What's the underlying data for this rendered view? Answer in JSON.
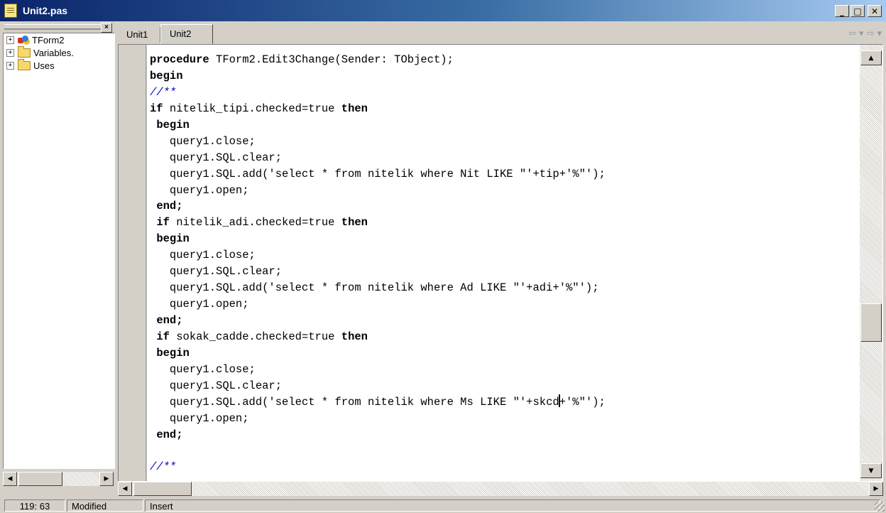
{
  "window": {
    "title": "Unit2.pas",
    "buttons": [
      "minimize",
      "maximize",
      "close"
    ]
  },
  "explorer": {
    "close_label": "×",
    "items": [
      {
        "expander": "+",
        "icon": "form-icon",
        "label": "TForm2"
      },
      {
        "expander": "+",
        "icon": "folder-icon",
        "label": "Variables."
      },
      {
        "expander": "+",
        "icon": "folder-icon",
        "label": "Uses"
      }
    ]
  },
  "editor": {
    "tabs": [
      {
        "label": "Unit1",
        "active": false
      },
      {
        "label": "Unit2",
        "active": true
      }
    ],
    "nav": {
      "back": "⇦",
      "back_drop": "▾",
      "forward": "⇨",
      "forward_drop": "▾"
    },
    "code_lines": [
      {
        "segments": [
          {
            "t": "procedure",
            "k": "kw"
          },
          {
            "t": " TForm2.Edit3Change(Sender: TObject);"
          }
        ]
      },
      {
        "segments": [
          {
            "t": "begin",
            "k": "kw"
          }
        ]
      },
      {
        "segments": [
          {
            "t": "//**",
            "k": "cm"
          }
        ]
      },
      {
        "segments": [
          {
            "t": "if",
            "k": "kw"
          },
          {
            "t": " nitelik_tipi.checked=true "
          },
          {
            "t": "then",
            "k": "kw"
          }
        ]
      },
      {
        "segments": [
          {
            "t": " "
          },
          {
            "t": "begin",
            "k": "kw"
          }
        ]
      },
      {
        "segments": [
          {
            "t": "   query1.close;"
          }
        ]
      },
      {
        "segments": [
          {
            "t": "   query1.SQL.clear;"
          }
        ]
      },
      {
        "segments": [
          {
            "t": "   query1.SQL.add('select * from nitelik where Nit LIKE \"'+tip+'%\"');"
          }
        ]
      },
      {
        "segments": [
          {
            "t": "   query1.open;"
          }
        ]
      },
      {
        "segments": [
          {
            "t": " "
          },
          {
            "t": "end;",
            "k": "kw"
          }
        ]
      },
      {
        "segments": [
          {
            "t": " "
          },
          {
            "t": "if",
            "k": "kw"
          },
          {
            "t": " nitelik_adi.checked=true "
          },
          {
            "t": "then",
            "k": "kw"
          }
        ]
      },
      {
        "segments": [
          {
            "t": " "
          },
          {
            "t": "begin",
            "k": "kw"
          }
        ]
      },
      {
        "segments": [
          {
            "t": "   query1.close;"
          }
        ]
      },
      {
        "segments": [
          {
            "t": "   query1.SQL.clear;"
          }
        ]
      },
      {
        "segments": [
          {
            "t": "   query1.SQL.add('select * from nitelik where Ad LIKE \"'+adi+'%\"');"
          }
        ]
      },
      {
        "segments": [
          {
            "t": "   query1.open;"
          }
        ]
      },
      {
        "segments": [
          {
            "t": " "
          },
          {
            "t": "end;",
            "k": "kw"
          }
        ]
      },
      {
        "segments": [
          {
            "t": " "
          },
          {
            "t": "if",
            "k": "kw"
          },
          {
            "t": " sokak_cadde.checked=true "
          },
          {
            "t": "then",
            "k": "kw"
          }
        ]
      },
      {
        "segments": [
          {
            "t": " "
          },
          {
            "t": "begin",
            "k": "kw"
          }
        ]
      },
      {
        "segments": [
          {
            "t": "   query1.close;"
          }
        ]
      },
      {
        "segments": [
          {
            "t": "   query1.SQL.clear;"
          }
        ]
      },
      {
        "segments": [
          {
            "t": "   query1.SQL.add('select * from nitelik where Ms LIKE \"'+skcd"
          },
          {
            "t": "",
            "k": "caret"
          },
          {
            "t": "+'%\"');"
          }
        ]
      },
      {
        "segments": [
          {
            "t": "   query1.open;"
          }
        ]
      },
      {
        "segments": [
          {
            "t": " "
          },
          {
            "t": "end;",
            "k": "kw"
          }
        ]
      },
      {
        "segments": [
          {
            "t": ""
          }
        ]
      },
      {
        "segments": [
          {
            "t": "//**",
            "k": "cm"
          }
        ]
      }
    ],
    "vscroll_position": 0.6
  },
  "status": {
    "position": "119: 63",
    "modified": "Modified",
    "mode": "Insert"
  }
}
